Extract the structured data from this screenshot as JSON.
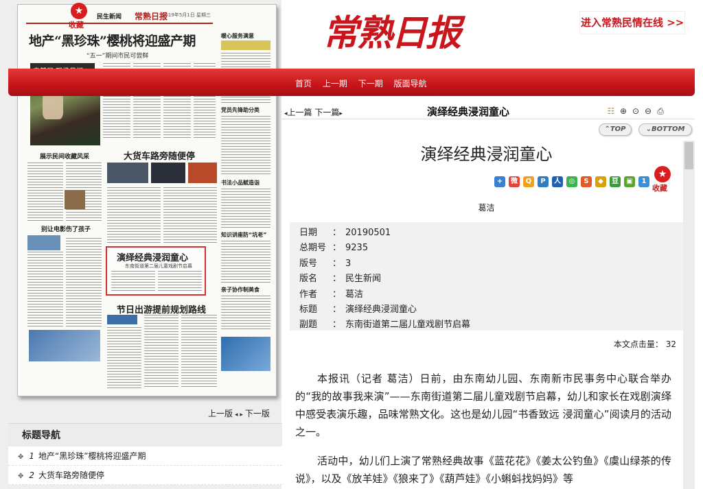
{
  "left": {
    "paper": {
      "section_name": "民生新闻",
      "masthead": "常熟日报",
      "date_text": "2019年5月1日 星期三",
      "headline": "地产“黑珍珠”樱桃将迎盛产期",
      "subheadline": "“五一”期间市民可尝鲜",
      "photo_band": "走基层·现场见闻",
      "side_heads": [
        "暖心服务满意",
        "党员先锋助分类",
        "书法小品赋造诣",
        "知识讲座防“坑老”",
        "亲子协作制美食"
      ],
      "article_heads": [
        "展示民间收藏风采",
        "别让电影伤了孩子",
        "大货车路旁随便停",
        "节日出游提前规划路线"
      ],
      "highlight_title": "演绎经典浸润童心",
      "highlight_sub": "东南街道第二届儿童戏剧节启幕"
    },
    "collect_label": "收藏",
    "page_nav": {
      "prev": "上一版",
      "next": "下一版"
    },
    "topic_nav": {
      "title": "标题导航",
      "items": [
        {
          "index": "1",
          "text": "地产“黑珍珠”樱桃将迎盛产期"
        },
        {
          "index": "2",
          "text": "大货车路旁随便停"
        }
      ]
    }
  },
  "header": {
    "logo": "常熟日报",
    "promo": "进入常熟民情在线 >>",
    "menu": [
      "首页",
      "上一期",
      "下一期",
      "版面导航"
    ]
  },
  "article_bar": {
    "prev": "上一篇",
    "next": "下一篇",
    "title": "演绎经典浸润童心",
    "tools": [
      "list-icon",
      "zoom-in-icon",
      "zoom-reset-icon",
      "zoom-out-icon",
      "print-icon"
    ]
  },
  "jump": {
    "top": "TOP",
    "bottom": "BOTTOM"
  },
  "article": {
    "title": "演绎经典浸润童心",
    "collect_label": "收藏",
    "author_line": "葛洁",
    "meta": [
      {
        "key": "日期",
        "value": "20190501"
      },
      {
        "key": "总期号",
        "value": "9235"
      },
      {
        "key": "版号",
        "value": "3"
      },
      {
        "key": "版名",
        "value": "民生新闻"
      },
      {
        "key": "作者",
        "value": "葛洁"
      },
      {
        "key": "标题",
        "value": "演绎经典浸润童心"
      },
      {
        "key": "副题",
        "value": "东南街道第二届儿童戏剧节启幕"
      }
    ],
    "hits_label": "本文点击量：",
    "hits_value": "32",
    "paragraphs": [
      "本报讯（记者 葛洁）日前，由东南幼儿园、东南新市民事务中心联合举办的“我的故事我来演”——东南街道第二届儿童戏剧节启幕，幼儿和家长在戏剧演绎中感受表演乐趣，品味常熟文化。这也是幼儿园“书香致远 浸润童心”阅读月的活动之一。",
      "活动中，幼儿们上演了常熟经典故事《蓝花花》《姜太公钓鱼》《虞山绿茶的传说》，以及《放羊娃》《狼来了》《葫芦娃》《小蝌蚪找妈妈》等"
    ],
    "share_icons": [
      {
        "name": "share-more-icon",
        "glyph": "+",
        "color": "#3b7fd0"
      },
      {
        "name": "share-weibo-icon",
        "glyph": "微",
        "color": "#e0443a"
      },
      {
        "name": "share-qzone-icon",
        "glyph": "Q",
        "color": "#f0a21c"
      },
      {
        "name": "share-tqq-icon",
        "glyph": "P",
        "color": "#2d7fc2"
      },
      {
        "name": "share-renren-icon",
        "glyph": "人",
        "color": "#1f5fb8"
      },
      {
        "name": "share-wechat-icon",
        "glyph": "◎",
        "color": "#3fb34f"
      },
      {
        "name": "share-sohu-icon",
        "glyph": "S",
        "color": "#e05a2a"
      },
      {
        "name": "share-fav-icon",
        "glyph": "◆",
        "color": "#d8a10a"
      },
      {
        "name": "share-douban-icon",
        "glyph": "豆",
        "color": "#3f9a3f"
      },
      {
        "name": "share-image-icon",
        "glyph": "▣",
        "color": "#58a72c"
      },
      {
        "name": "share-count-icon",
        "glyph": "1",
        "color": "#3a8fd9"
      }
    ]
  },
  "colors": {
    "brand_red": "#c8171b",
    "collect_red": "#d81e1e"
  }
}
